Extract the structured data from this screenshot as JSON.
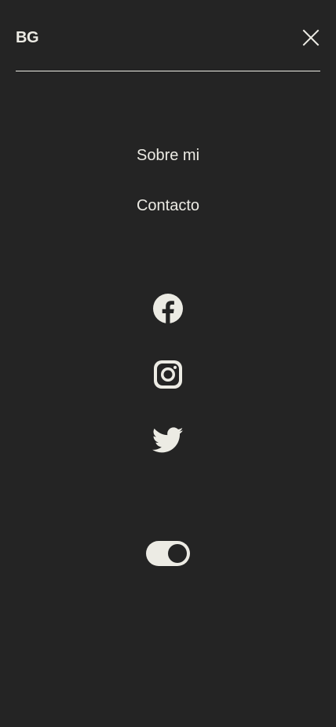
{
  "header": {
    "logo_text": "BG"
  },
  "nav": {
    "items": [
      {
        "label": "Sobre mi"
      },
      {
        "label": "Contacto"
      }
    ]
  },
  "social": {
    "icons": [
      "facebook-icon",
      "instagram-icon",
      "twitter-icon"
    ]
  },
  "theme_toggle": {
    "state": "on"
  },
  "colors": {
    "background": "#242424",
    "foreground": "#ecebe4"
  }
}
